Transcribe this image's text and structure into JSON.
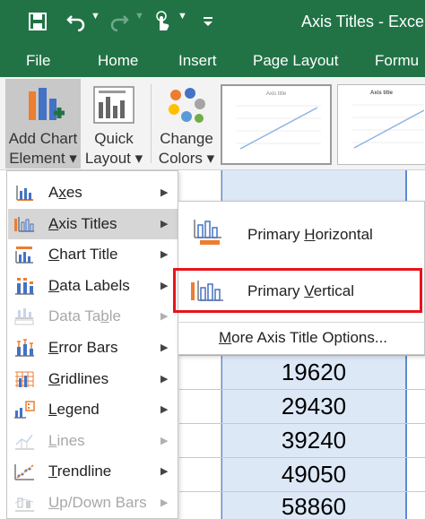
{
  "titlebar": {
    "title": "Axis Titles - Excel",
    "save_icon": "save-icon",
    "undo_icon": "undo-icon",
    "redo_icon": "redo-icon",
    "touch_icon": "touch-mode-icon",
    "customize_icon": "customize-qat-icon",
    "bg_color": "#217346"
  },
  "tabs": [
    "File",
    "Home",
    "Insert",
    "Page Layout",
    "Formu"
  ],
  "ribbon": {
    "add_chart_element": [
      "Add Chart",
      "Element ▾"
    ],
    "quick_layout": [
      "Quick",
      "Layout ▾"
    ],
    "change_colors": [
      "Change",
      "Colors ▾"
    ],
    "chart_style_1_title": "Axis title",
    "chart_style_2_title": "Axis title"
  },
  "menu": {
    "items": [
      {
        "pre": "A",
        "u": "x",
        "post": "es",
        "disabled": false,
        "icon": "axes-icon"
      },
      {
        "pre": "",
        "u": "A",
        "post": "xis Titles",
        "disabled": false,
        "icon": "axis-titles-icon"
      },
      {
        "pre": "",
        "u": "C",
        "post": "hart Title",
        "disabled": false,
        "icon": "chart-title-icon"
      },
      {
        "pre": "",
        "u": "D",
        "post": "ata Labels",
        "disabled": false,
        "icon": "data-labels-icon"
      },
      {
        "pre": "Data Ta",
        "u": "b",
        "post": "le",
        "disabled": true,
        "icon": "data-table-icon"
      },
      {
        "pre": "",
        "u": "E",
        "post": "rror Bars",
        "disabled": false,
        "icon": "error-bars-icon"
      },
      {
        "pre": "",
        "u": "G",
        "post": "ridlines",
        "disabled": false,
        "icon": "gridlines-icon"
      },
      {
        "pre": "",
        "u": "L",
        "post": "egend",
        "disabled": false,
        "icon": "legend-icon"
      },
      {
        "pre": "",
        "u": "L",
        "post": "ines",
        "disabled": true,
        "icon": "lines-icon"
      },
      {
        "pre": "",
        "u": "T",
        "post": "rendline",
        "disabled": false,
        "icon": "trendline-icon"
      },
      {
        "pre": "",
        "u": "U",
        "post": "p/Down Bars",
        "disabled": true,
        "icon": "up-down-bars-icon"
      }
    ],
    "highlighted_index": 1
  },
  "submenu": {
    "primary_horizontal": {
      "pre": "Primary ",
      "u": "H",
      "post": "orizontal"
    },
    "primary_vertical": {
      "pre": "Primary ",
      "u": "V",
      "post": "ertical"
    },
    "more_options": {
      "pre": "",
      "u": "M",
      "post": "ore Axis Title Options..."
    }
  },
  "cells": [
    "19620",
    "29430",
    "39240",
    "49050",
    "58860"
  ],
  "colors": {
    "excel_green": "#217346",
    "highlight_red": "#e8141b",
    "selection_blue": "#5b8ad1",
    "icon_blue": "#4472c4",
    "icon_orange": "#ed7d31"
  }
}
